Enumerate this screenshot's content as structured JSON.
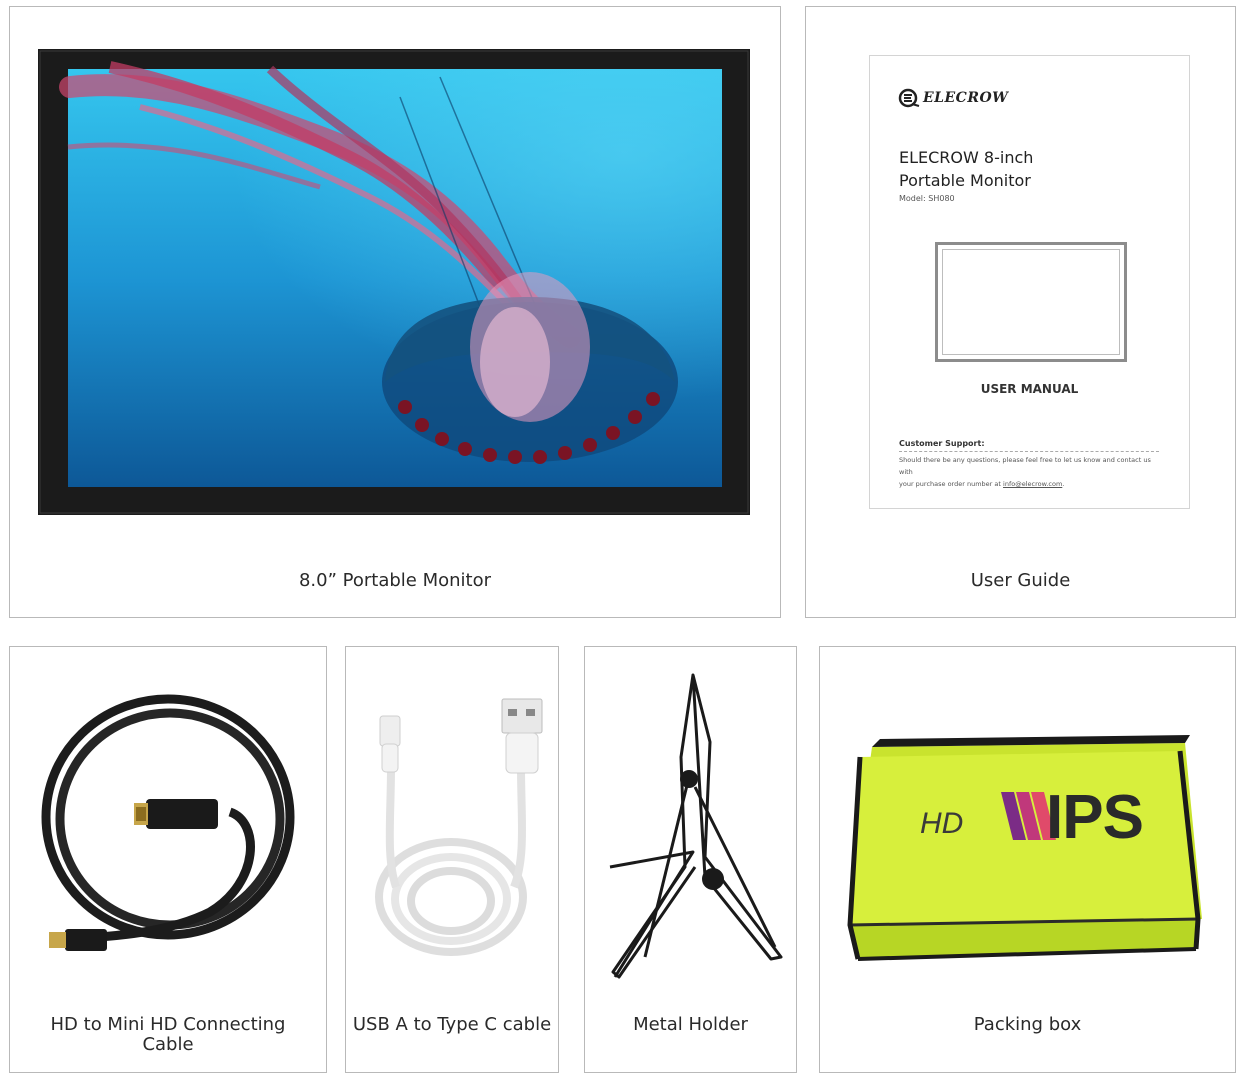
{
  "products": [
    {
      "id": "monitor",
      "caption": "8.0” Portable Monitor"
    },
    {
      "id": "guide",
      "caption": "User Guide"
    },
    {
      "id": "hdmi",
      "caption_line1": "HD to Mini HD Connecting",
      "caption_line2": "Cable"
    },
    {
      "id": "usb",
      "caption": "USB A to Type C cable"
    },
    {
      "id": "holder",
      "caption": "Metal Holder"
    },
    {
      "id": "box",
      "caption": "Packing box"
    }
  ],
  "manual": {
    "brand": "ELECROW",
    "title_line1": "ELECROW 8-inch",
    "title_line2": "Portable Monitor",
    "model": "Model: SH080",
    "heading": "USER MANUAL",
    "support_title": "Customer Support:",
    "support_text_1": "Should there be any questions, please feel free to let us know and contact us with",
    "support_text_2": "your purchase order number at ",
    "support_email": "info@elecrow.com",
    "support_end": "."
  },
  "box_print": {
    "hd": "HD",
    "ips": "IPS"
  },
  "colors": {
    "screen_top": "#38cbf0",
    "screen_bottom": "#0e5d9e",
    "box_lid": "#d7f03a",
    "box_side": "#bcdc2a",
    "bezel": "#1a1a1a"
  },
  "icons": [
    "elecrow-logo-icon",
    "jellyfish-image-icon",
    "hdmi-cable-icon",
    "usb-c-cable-icon",
    "metal-stand-icon",
    "packing-box-icon"
  ]
}
